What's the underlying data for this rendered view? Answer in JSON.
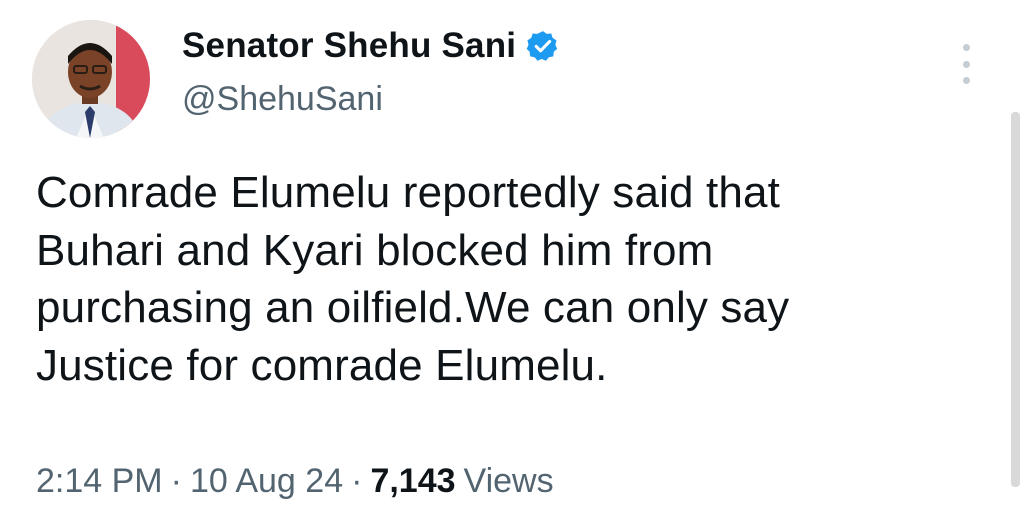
{
  "user": {
    "display_name": "Senator Shehu Sani",
    "handle": "@ShehuSani",
    "verified_icon": "verified-badge-icon",
    "badge_color": "#1d9bf0"
  },
  "tweet": {
    "lines": [
      "Comrade Elumelu reportedly said that",
      "Buhari and Kyari blocked him from",
      "purchasing an oilfield.We can only say",
      "Justice for comrade Elumelu."
    ]
  },
  "meta": {
    "time": "2:14 PM",
    "separator": "·",
    "date": "10 Aug 24",
    "views_count": "7,143",
    "views_label": "Views"
  },
  "icons": {
    "more": "more-vertical-icon"
  }
}
